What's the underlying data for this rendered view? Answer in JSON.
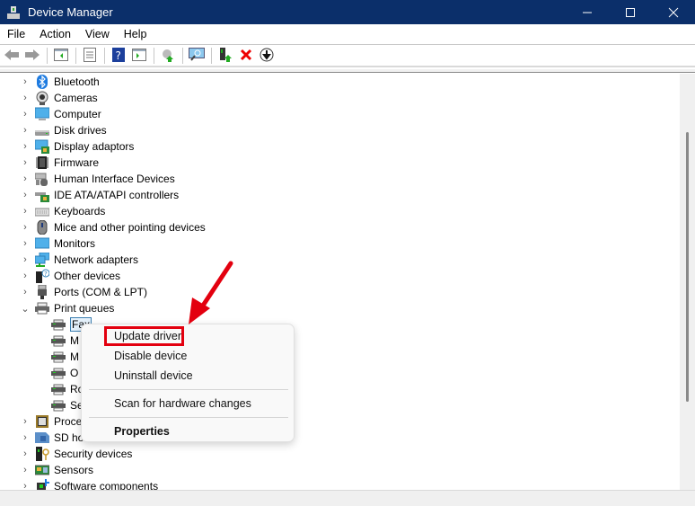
{
  "window": {
    "title": "Device Manager",
    "controls": [
      "minimize",
      "maximize",
      "close"
    ]
  },
  "menubar": [
    "File",
    "Action",
    "View",
    "Help"
  ],
  "toolbar": [
    "back-icon",
    "forward-icon",
    "show-hide-console-tree-icon",
    "properties-icon",
    "help-icon",
    "show-action-pane-icon",
    "update-driver-icon",
    "scan-hardware-icon",
    "enable-device-icon",
    "uninstall-device-icon",
    "disable-device-icon"
  ],
  "tree": [
    {
      "label": "Bluetooth",
      "icon": "bluetooth-icon",
      "expanded": false
    },
    {
      "label": "Cameras",
      "icon": "camera-icon",
      "expanded": false
    },
    {
      "label": "Computer",
      "icon": "computer-icon",
      "expanded": false
    },
    {
      "label": "Disk drives",
      "icon": "disk-drive-icon",
      "expanded": false
    },
    {
      "label": "Display adaptors",
      "icon": "display-adapter-icon",
      "expanded": false
    },
    {
      "label": "Firmware",
      "icon": "firmware-icon",
      "expanded": false
    },
    {
      "label": "Human Interface Devices",
      "icon": "hid-icon",
      "expanded": false
    },
    {
      "label": "IDE ATA/ATAPI controllers",
      "icon": "ide-controller-icon",
      "expanded": false
    },
    {
      "label": "Keyboards",
      "icon": "keyboard-icon",
      "expanded": false
    },
    {
      "label": "Mice and other pointing devices",
      "icon": "mouse-icon",
      "expanded": false
    },
    {
      "label": "Monitors",
      "icon": "monitor-icon",
      "expanded": false
    },
    {
      "label": "Network adapters",
      "icon": "network-adapter-icon",
      "expanded": false
    },
    {
      "label": "Other devices",
      "icon": "other-devices-icon",
      "expanded": false
    },
    {
      "label": "Ports (COM & LPT)",
      "icon": "port-icon",
      "expanded": false
    },
    {
      "label": "Print queues",
      "icon": "printer-icon",
      "expanded": true,
      "children": [
        {
          "label": "Fax",
          "selected": true
        },
        {
          "label": "M"
        },
        {
          "label": "M"
        },
        {
          "label": "O"
        },
        {
          "label": "Ro"
        },
        {
          "label": "Se"
        }
      ]
    },
    {
      "label": "Proce",
      "icon": "processor-icon",
      "expanded": false
    },
    {
      "label": "SD ho",
      "icon": "sd-host-icon",
      "expanded": false
    },
    {
      "label": "Security devices",
      "icon": "security-device-icon",
      "expanded": false
    },
    {
      "label": "Sensors",
      "icon": "sensor-icon",
      "expanded": false
    },
    {
      "label": "Software components",
      "icon": "software-component-icon",
      "expanded": false
    }
  ],
  "context_menu": {
    "items": [
      "Update driver",
      "Disable device",
      "Uninstall device",
      "Scan for hardware changes",
      "Properties"
    ],
    "highlighted": "Update driver",
    "bold": "Properties"
  },
  "annotation": {
    "color": "#e3000f"
  },
  "colors": {
    "titlebar": "#0b2f6a"
  }
}
